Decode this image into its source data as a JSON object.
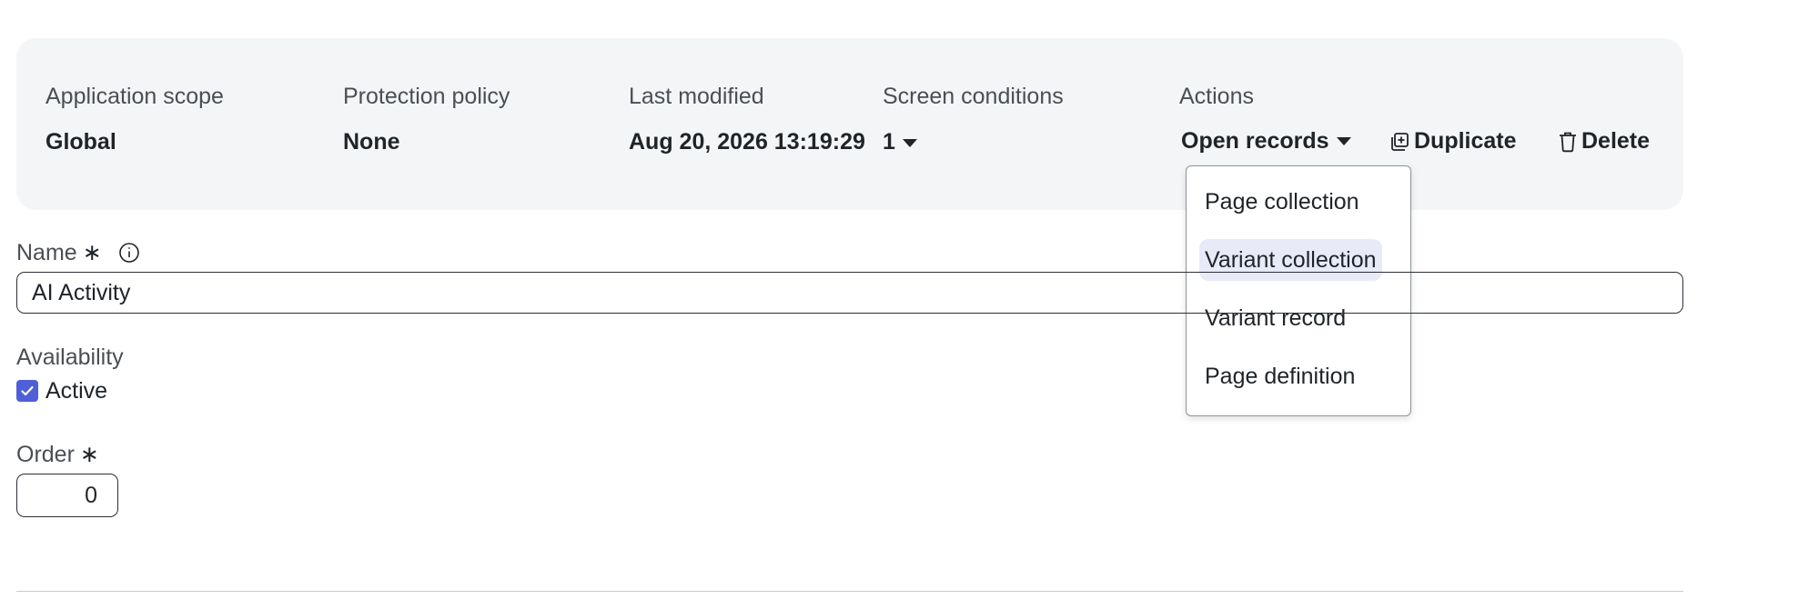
{
  "header": {
    "application_scope": {
      "label": "Application scope",
      "value": "Global"
    },
    "protection_policy": {
      "label": "Protection policy",
      "value": "None"
    },
    "last_modified": {
      "label": "Last modified",
      "value": "Aug 20, 2026 13:19:29"
    },
    "screen_conditions": {
      "label": "Screen conditions",
      "value": "1"
    },
    "actions": {
      "label": "Actions",
      "open_records": "Open records",
      "duplicate": "Duplicate",
      "delete": "Delete"
    }
  },
  "open_records_menu": {
    "items": [
      "Page collection",
      "Variant collection",
      "Variant record",
      "Page definition"
    ],
    "highlighted": "Variant collection"
  },
  "form": {
    "name": {
      "label": "Name",
      "required_mark": "∗",
      "value": "AI Activity"
    },
    "availability": {
      "label": "Availability",
      "checkbox_label": "Active",
      "checked": true
    },
    "order": {
      "label": "Order",
      "required_mark": "∗",
      "value": "0"
    }
  },
  "colors": {
    "accent": "#4f5fd8",
    "panel_bg": "#f4f5f7",
    "highlight": "#e8eaf8"
  }
}
